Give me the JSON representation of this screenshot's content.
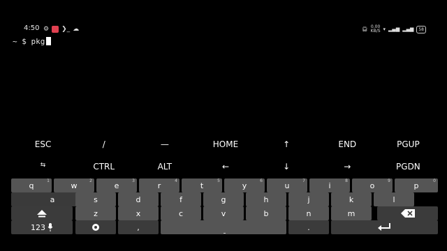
{
  "status_bar": {
    "time": "4:50",
    "left_icons": [
      "gear-icon",
      "app-notification-icon",
      "terminal-prompt-icon",
      "cloud-icon"
    ],
    "terminal_glyph": "❯_",
    "net_speed_value": "0.00",
    "net_speed_unit": "KB/S",
    "battery": "58"
  },
  "terminal": {
    "prompt": "~ $",
    "command": "pkg"
  },
  "extra_keys": {
    "row1": [
      "ESC",
      "/",
      "—",
      "HOME",
      "↑",
      "END",
      "PGUP"
    ],
    "row2": [
      "⇆",
      "CTRL",
      "ALT",
      "←",
      "↓",
      "→",
      "PGDN"
    ]
  },
  "keyboard": {
    "row1": [
      {
        "label": "q",
        "hint": "1"
      },
      {
        "label": "w",
        "hint": "2"
      },
      {
        "label": "e",
        "hint": "3"
      },
      {
        "label": "r",
        "hint": "4"
      },
      {
        "label": "t",
        "hint": "5"
      },
      {
        "label": "y",
        "hint": "6"
      },
      {
        "label": "u",
        "hint": "7"
      },
      {
        "label": "i",
        "hint": "8"
      },
      {
        "label": "o",
        "hint": "9"
      },
      {
        "label": "p",
        "hint": "0"
      }
    ],
    "row2": [
      "a",
      "s",
      "d",
      "f",
      "g",
      "h",
      "j",
      "k",
      "l"
    ],
    "row3": [
      "z",
      "x",
      "c",
      "v",
      "b",
      "n",
      "m"
    ],
    "symbols_key": "123",
    "comma_key": ",",
    "period_key": "."
  }
}
